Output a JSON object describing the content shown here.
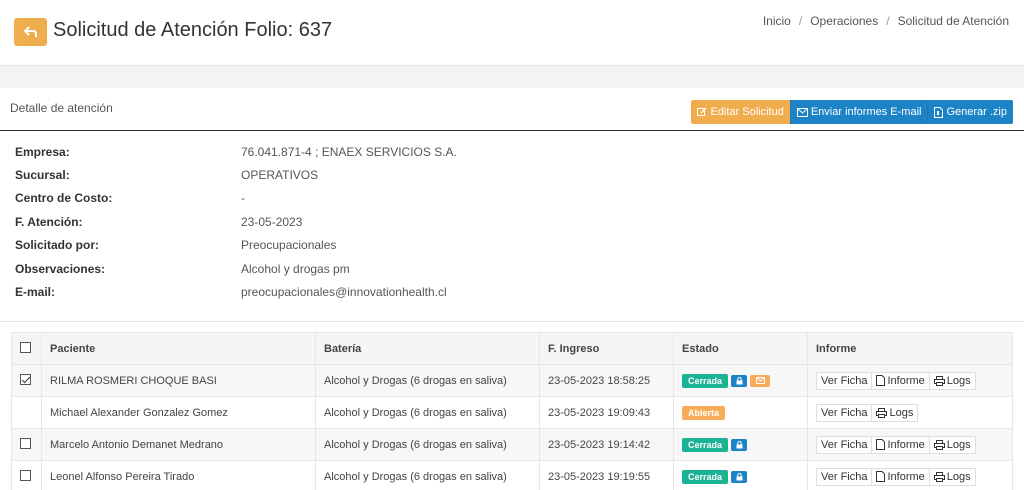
{
  "header": {
    "title": "Solicitud de Atención Folio: 637",
    "breadcrumb": [
      "Inicio",
      "Operaciones",
      "Solicitud de Atención"
    ]
  },
  "panel": {
    "title": "Detalle de atención",
    "buttons": {
      "edit": "Editar Solicitud",
      "email": "Enviar informes E-mail",
      "zip": "Generar .zip"
    }
  },
  "details": [
    {
      "label": "Empresa:",
      "value": "76.041.871-4 ; ENAEX SERVICIOS S.A."
    },
    {
      "label": "Sucursal:",
      "value": "OPERATIVOS"
    },
    {
      "label": "Centro de Costo:",
      "value": "-"
    },
    {
      "label": "F. Atención:",
      "value": "23-05-2023"
    },
    {
      "label": "Solicitado por:",
      "value": "Preocupacionales"
    },
    {
      "label": "Observaciones:",
      "value": "Alcohol y drogas pm"
    },
    {
      "label": "E-mail:",
      "value": "preocupacionales@innovationhealth.cl"
    }
  ],
  "table": {
    "columns": [
      "Paciente",
      "Batería",
      "F. Ingreso",
      "Estado",
      "Informe"
    ],
    "rows": [
      {
        "paciente": "RILMA ROSMERI CHOQUE BASI",
        "bateria": "Alcohol y Drogas (6 drogas en saliva)",
        "ingreso": "23-05-2023 18:58:25",
        "estado": "Cerrada"
      },
      {
        "paciente": "Michael Alexander Gonzalez Gomez",
        "bateria": "Alcohol y Drogas (6 drogas en saliva)",
        "ingreso": "23-05-2023 19:09:43",
        "estado": "Abierta"
      },
      {
        "paciente": "Marcelo Antonio Demanet Medrano",
        "bateria": "Alcohol y Drogas (6 drogas en saliva)",
        "ingreso": "23-05-2023 19:14:42",
        "estado": "Cerrada"
      },
      {
        "paciente": "Leonel Alfonso Pereira Tirado",
        "bateria": "Alcohol y Drogas (6 drogas en saliva)",
        "ingreso": "23-05-2023 19:19:55",
        "estado": "Cerrada"
      }
    ],
    "actions": {
      "ver": "Ver Ficha",
      "informe": "Informe",
      "logs": "Logs"
    }
  },
  "colors": {
    "warning": "#f0ad4e",
    "primary": "#1c84c6",
    "success": "#1ab394",
    "badge_orange": "#f8ac59"
  }
}
